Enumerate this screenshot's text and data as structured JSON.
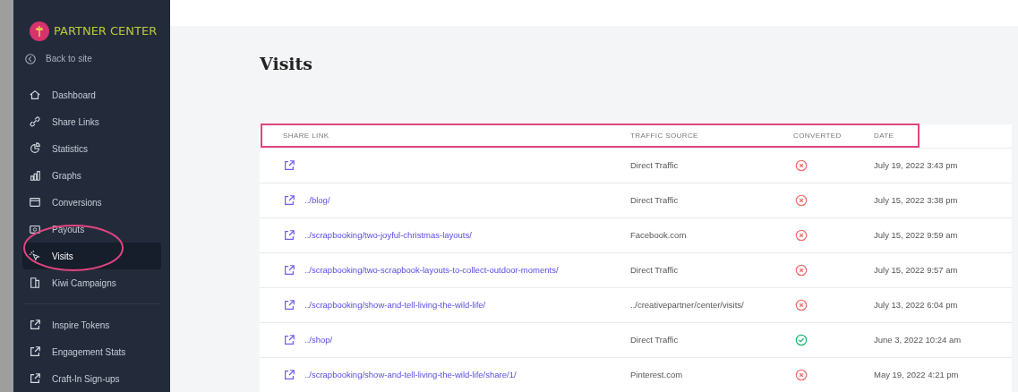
{
  "sidebar": {
    "logo_text": "PARTNER CENTER",
    "back_link": "Back to site",
    "items": [
      {
        "label": "Dashboard",
        "selected": false
      },
      {
        "label": "Share Links",
        "selected": false
      },
      {
        "label": "Statistics",
        "selected": false
      },
      {
        "label": "Graphs",
        "selected": false
      },
      {
        "label": "Conversions",
        "selected": false
      },
      {
        "label": "Payouts",
        "selected": false
      },
      {
        "label": "Visits",
        "selected": true
      },
      {
        "label": "Kiwi Campaigns",
        "selected": false
      }
    ],
    "external_links": [
      "Inspire Tokens",
      "Engagement Stats",
      "Craft-In Sign-ups"
    ]
  },
  "page_title": "Visits",
  "table": {
    "columns": [
      "SHARE LINK",
      "TRAFFIC SOURCE",
      "CONVERTED",
      "DATE"
    ],
    "rows": [
      {
        "share_link": "",
        "traffic_source": "Direct Traffic",
        "converted": false,
        "date": "July 19, 2022 3:43 pm"
      },
      {
        "share_link": "../blog/",
        "traffic_source": "Direct Traffic",
        "converted": false,
        "date": "July 15, 2022 3:38 pm"
      },
      {
        "share_link": "../scrapbooking/two-joyful-christmas-layouts/",
        "traffic_source": "Facebook.com",
        "converted": false,
        "date": "July 15, 2022 9:59 am"
      },
      {
        "share_link": "../scrapbooking/two-scrapbook-layouts-to-collect-outdoor-moments/",
        "traffic_source": "Direct Traffic",
        "converted": false,
        "date": "July 15, 2022 9:57 am"
      },
      {
        "share_link": "../scrapbooking/show-and-tell-living-the-wild-life/",
        "traffic_source": "../creativepartner/center/visits/",
        "converted": false,
        "date": "July 13, 2022 6:04 pm"
      },
      {
        "share_link": "../shop/",
        "traffic_source": "Direct Traffic",
        "converted": true,
        "date": "June 3, 2022 10:24 am"
      },
      {
        "share_link": "../scrapbooking/show-and-tell-living-the-wild-life/share/1/",
        "traffic_source": "Pinterest.com",
        "converted": false,
        "date": "May 19, 2022 4:21 pm"
      }
    ]
  }
}
